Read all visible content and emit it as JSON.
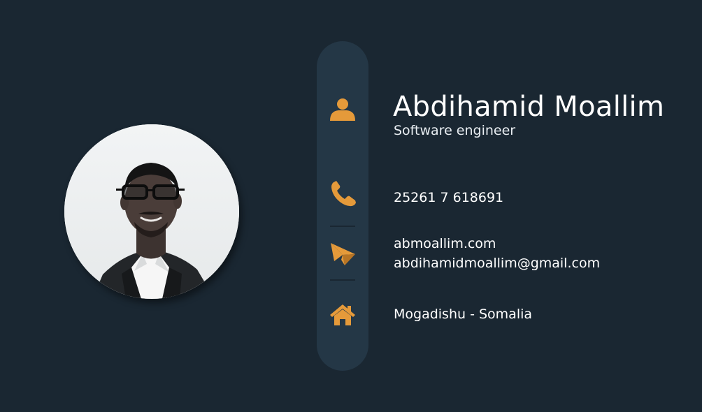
{
  "card": {
    "name": "Abdihamid Moallim",
    "role": "Software engineer",
    "phone": "25261 7 618691",
    "website": "abmoallim.com",
    "email": "abdihamidmoallim@gmail.com",
    "location": "Mogadishu - Somalia"
  },
  "icons": {
    "profile": "person-icon",
    "phone": "phone-icon",
    "contact": "paper-plane-icon",
    "location": "home-icon"
  },
  "colors": {
    "background": "#1a2732",
    "strip": "#243746",
    "accent": "#e59a3a",
    "text": "#ffffff"
  }
}
